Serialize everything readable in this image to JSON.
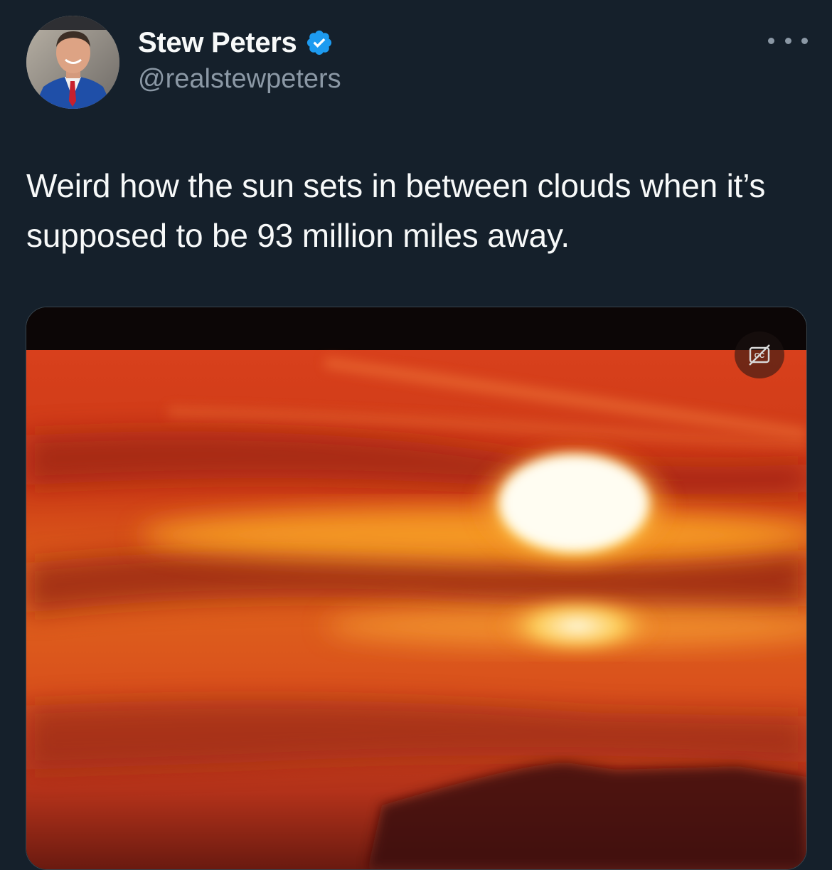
{
  "author": {
    "display_name": "Stew Peters",
    "handle": "@realstewpeters",
    "verified": true,
    "avatar_icon": "profile-photo"
  },
  "tweet": {
    "text": "Weird how the sun sets in between clouds when it’s supposed to be 93 million miles away."
  },
  "media": {
    "type": "video",
    "description_icon": "sunset-video",
    "captions_icon": "captions-off-icon"
  },
  "colors": {
    "background": "#15202b",
    "verified_blue": "#1d9bf0",
    "secondary_text": "#8b98a5"
  }
}
